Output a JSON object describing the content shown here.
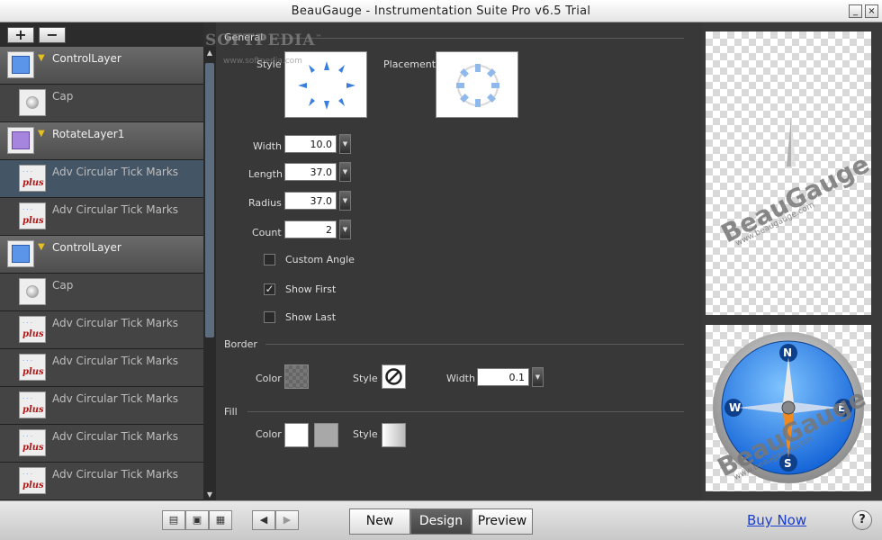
{
  "window": {
    "title": "BeauGauge - Instrumentation Suite Pro v6.5 Trial",
    "minimize": "_",
    "close": "×"
  },
  "sidebar": {
    "add_label": "+",
    "remove_label": "−",
    "layers": [
      {
        "name": "ControlLayer",
        "kind": "control"
      },
      {
        "name": "Cap",
        "kind": "cap"
      },
      {
        "name": "RotateLayer1",
        "kind": "rotate"
      },
      {
        "name": "Adv Circular Tick Marks",
        "kind": "ticks"
      },
      {
        "name": "Adv Circular Tick Marks",
        "kind": "ticks"
      },
      {
        "name": "ControlLayer",
        "kind": "control"
      },
      {
        "name": "Cap",
        "kind": "cap"
      },
      {
        "name": "Adv Circular Tick Marks",
        "kind": "ticks"
      },
      {
        "name": "Adv Circular Tick Marks",
        "kind": "ticks"
      },
      {
        "name": "Adv Circular Tick Marks",
        "kind": "ticks"
      },
      {
        "name": "Adv Circular Tick Marks",
        "kind": "ticks"
      },
      {
        "name": "Adv Circular Tick Marks",
        "kind": "ticks"
      }
    ],
    "plus_text": "plus"
  },
  "editor": {
    "general": {
      "section": "General",
      "style_label": "Style",
      "placement_label": "Placement",
      "width_label": "Width",
      "width_value": "10.0",
      "length_label": "Length",
      "length_value": "37.0",
      "radius_label": "Radius",
      "radius_value": "37.0",
      "count_label": "Count",
      "count_value": "2",
      "custom_angle_label": "Custom Angle",
      "custom_angle_checked": false,
      "show_first_label": "Show First",
      "show_first_checked": true,
      "show_last_label": "Show Last",
      "show_last_checked": false
    },
    "border": {
      "section": "Border",
      "color_label": "Color",
      "style_label": "Style",
      "width_label": "Width",
      "width_value": "0.1"
    },
    "fill": {
      "section": "Fill",
      "color_label": "Color",
      "style_label": "Style"
    }
  },
  "preview": {
    "watermark_brand": "BeauGauge",
    "watermark_url": "www.beaugauge.com",
    "compass": {
      "n": "N",
      "s": "S",
      "e": "E",
      "w": "W"
    }
  },
  "watermark": {
    "softpedia": "SOFTPEDIA",
    "softpedia_tm": "™",
    "softpedia_url": "www.softpedia.com"
  },
  "bottom": {
    "new_label": "New",
    "design_label": "Design",
    "preview_label": "Preview",
    "buy_now": "Buy Now",
    "help": "?"
  },
  "colors": {
    "accent": "#3a7fe0",
    "tick_blue": "#3a7fe0"
  }
}
